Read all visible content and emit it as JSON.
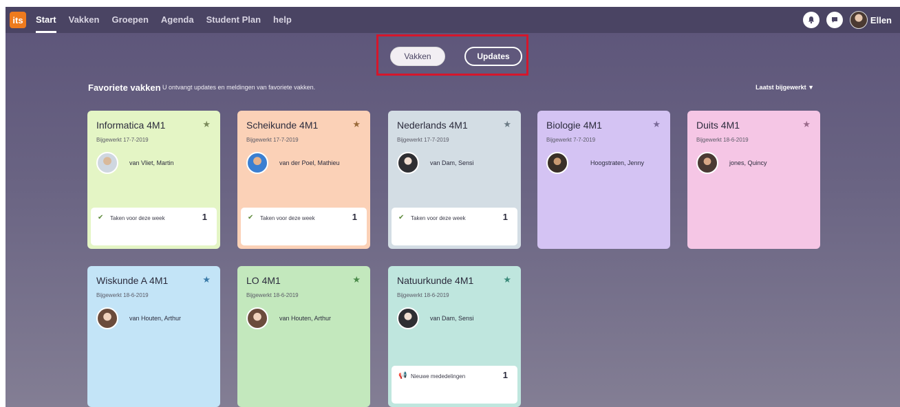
{
  "nav": {
    "logo": "its",
    "items": [
      "Start",
      "Vakken",
      "Groepen",
      "Agenda",
      "Student Plan",
      "help"
    ],
    "user_name": "Ellen"
  },
  "toggle": {
    "vakken": "Vakken",
    "updates": "Updates"
  },
  "section": {
    "title": "Favoriete vakken",
    "subtitle": "U ontvangt updates en meldingen van favoriete vakken.",
    "sort": "Laatst bijgewerkt ▼"
  },
  "cards": [
    {
      "title": "Informatica 4M1",
      "date": "Bijgewerkt 17-7-2019",
      "teacher": "van Vliet, Martin",
      "color": "#e4f5c5",
      "star_color": "#7a8a5a",
      "task": {
        "label": "Taken voor deze week",
        "count": "1",
        "icon": "check-icon"
      }
    },
    {
      "title": "Scheikunde 4M1",
      "date": "Bijgewerkt 17-7-2019",
      "teacher": "van der Poel, Mathieu",
      "color": "#fbd1b7",
      "star_color": "#9a6a3a",
      "task": {
        "label": "Taken voor deze week",
        "count": "1",
        "icon": "check-icon"
      }
    },
    {
      "title": "Nederlands 4M1",
      "date": "Bijgewerkt 17-7-2019",
      "teacher": "van Dam, Sensi",
      "color": "#d3dde4",
      "star_color": "#6a7a84",
      "task": {
        "label": "Taken voor deze week",
        "count": "1",
        "icon": "check-icon"
      }
    },
    {
      "title": "Biologie 4M1",
      "date": "Bijgewerkt 7-7-2019",
      "teacher": "Hoogstraten, Jenny",
      "color": "#d4c3f3",
      "star_color": "#7a6a98",
      "task": null
    },
    {
      "title": "Duits 4M1",
      "date": "Bijgewerkt 18-6-2019",
      "teacher": "jones, Quincy",
      "color": "#f5c6e5",
      "star_color": "#9a6a8a",
      "task": null
    },
    {
      "title": "Wiskunde A 4M1",
      "date": "Bijgewerkt 18-6-2019",
      "teacher": "van Houten, Arthur",
      "color": "#c3e4f7",
      "star_color": "#3a7aa8",
      "task": null
    },
    {
      "title": "LO 4M1",
      "date": "Bijgewerkt 18-6-2019",
      "teacher": "van Houten, Arthur",
      "color": "#c3e8bd",
      "star_color": "#4a8a4a",
      "task": null
    },
    {
      "title": "Natuurkunde 4M1",
      "date": "Bijgewerkt 18-6-2019",
      "teacher": "van Dam, Sensi",
      "color": "#bfe6de",
      "star_color": "#3a8a7a",
      "task": {
        "label": "Nieuwe mededelingen",
        "count": "1",
        "icon": "megaphone-icon"
      }
    }
  ]
}
